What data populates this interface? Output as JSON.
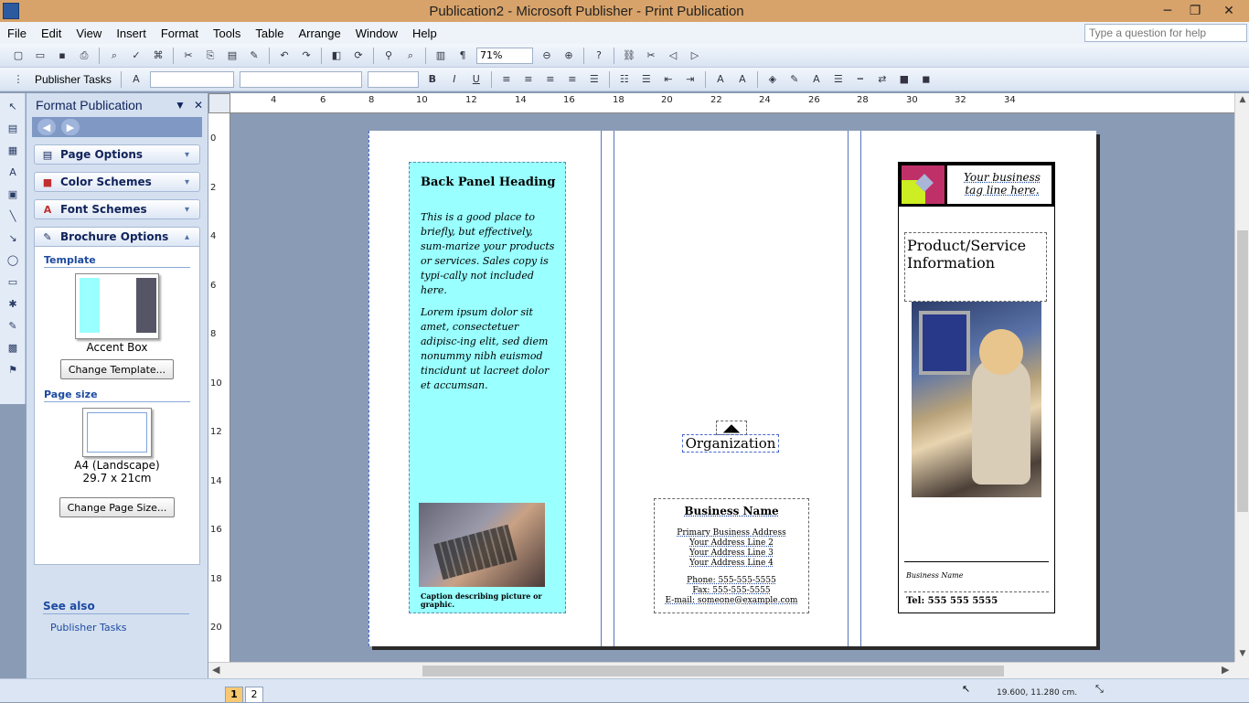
{
  "window": {
    "title": "Publication2 - Microsoft Publisher - Print Publication",
    "minimize": "─",
    "restore": "❐",
    "close": "✕"
  },
  "menubar": {
    "items": [
      "File",
      "Edit",
      "View",
      "Insert",
      "Format",
      "Tools",
      "Table",
      "Arrange",
      "Window",
      "Help"
    ],
    "help_placeholder": "Type a question for help"
  },
  "toolbar": {
    "zoom": "71%",
    "publisher_tasks": "Publisher Tasks"
  },
  "taskpane": {
    "title": "Format Publication",
    "sections": {
      "page_options": "Page Options",
      "color_schemes": "Color Schemes",
      "font_schemes": "Font Schemes",
      "brochure_options": "Brochure Options"
    },
    "template_heading": "Template",
    "template_name": "Accent Box",
    "change_template": "Change Template...",
    "page_size_heading": "Page size",
    "page_size_name": "A4 (Landscape)",
    "page_size_dims": "29.7 x 21cm",
    "change_page_size": "Change Page Size...",
    "see_also": "See also",
    "see_also_link": "Publisher Tasks"
  },
  "ruler": {
    "top": [
      "4",
      "6",
      "8",
      "10",
      "12",
      "14",
      "16",
      "18",
      "20",
      "22",
      "24",
      "26",
      "28",
      "30",
      "32",
      "34"
    ],
    "left": [
      "0",
      "2",
      "4",
      "6",
      "8",
      "10",
      "12",
      "14",
      "16",
      "18",
      "20"
    ]
  },
  "publication": {
    "back_heading": "Back Panel Heading",
    "back_text_1": "This is a good place to briefly, but effectively, sum-marize your products or services. Sales copy is typi-cally not included here.",
    "back_text_2": "Lorem ipsum dolor sit amet, consectetuer adipisc-ing elit, sed diem nonummy nibh euismod tincidunt ut lacreet dolor et accumsan.",
    "caption": "Caption describing picture or graphic.",
    "organization": "Organization",
    "business_name": "Business Name",
    "address": [
      "Primary Business Address",
      "Your Address Line 2",
      "Your Address Line 3",
      "Your Address Line 4"
    ],
    "phone": "Phone: 555-555-5555",
    "fax": "Fax: 555-555-5555",
    "email": "E-mail: someone@example.com",
    "tagline": "Your business tag line here.",
    "product_title": "Product/Service Information",
    "back_business_name": "Business Name",
    "tel": "Tel: 555 555 5555"
  },
  "status": {
    "pages": [
      "1",
      "2"
    ],
    "coordinates": "19.600, 11.280 cm."
  }
}
